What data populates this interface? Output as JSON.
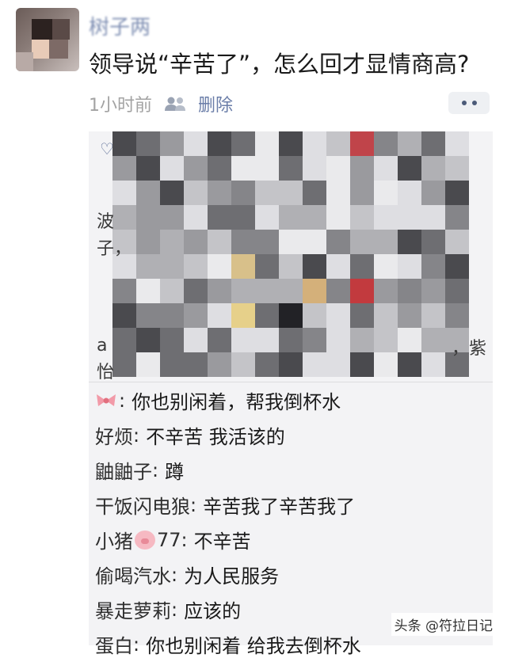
{
  "post": {
    "username": "树子两",
    "text": "领导说“辛苦了”，怎么回才显情商高?",
    "time": "1小时前",
    "delete_label": "删除",
    "visibility_icon": "people-icon",
    "more_icon": "more-dots-icon"
  },
  "likes": {
    "heart_icon": "heart-icon",
    "visible_fragments": [
      "波",
      "子，",
      "a",
      "怡",
      "，紫"
    ]
  },
  "comments": [
    {
      "name": "",
      "icon": "bow-emoji",
      "text": "你也别闲着，帮我倒杯水"
    },
    {
      "name": "好烦",
      "text": "不辛苦 我活该的"
    },
    {
      "name": "鼬鼬子",
      "text": "蹲"
    },
    {
      "name": "干饭闪电狼",
      "text": "辛苦我了辛苦我了"
    },
    {
      "name": "小猪",
      "icon": "pig-emoji",
      "name_suffix": "77",
      "text": "不辛苦"
    },
    {
      "name": "偷喝汽水",
      "text": "为人民服务"
    },
    {
      "name": "暴走萝莉",
      "text": "应该的"
    },
    {
      "name": "蛋白",
      "text": "你也别闲着 给我去倒杯水"
    }
  ],
  "watermark": "头条 @符拉日记",
  "colors": {
    "link": "#6a7da8",
    "background": "#ffffff",
    "comment_bg": "#f3f3f5"
  }
}
